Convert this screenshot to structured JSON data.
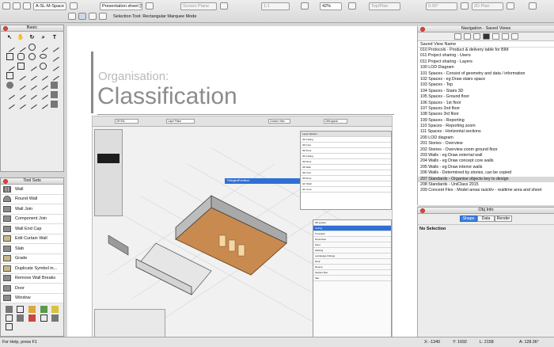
{
  "toolbar": {
    "class_select": "A-SL-M-Space",
    "sheet_select": "Presentation sheet [Sh...",
    "plane_select": "Screen Plane",
    "scale_value": "1:1",
    "zoom_value": "42%",
    "view_select": "Top/Plan",
    "angle_value": "0.00°",
    "render_select": "2D Plan",
    "status_text": "Selection Tool: Rectangular Marquee Mode"
  },
  "basic_palette": {
    "title": "Basic"
  },
  "tool_sets": {
    "title": "Tool Sets",
    "items": [
      "Wall",
      "Round Wall",
      "Wall Join",
      "Component Join",
      "Wall End Cap",
      "Edit Curtain Wall",
      "Slab",
      "Grade",
      "Duplicate Symbol in...",
      "Remove Wall Breaks",
      "Door",
      "Window"
    ]
  },
  "slide": {
    "subtitle": "Organisation:",
    "title": "Classification"
  },
  "embedded_screenshot": {
    "dropdown_label": "FittingIndFurniture",
    "field1": "Off  SSL",
    "field2": "Layer Plane",
    "field3": "Custom View",
    "field4": "Orthogonal",
    "layer_panel_header": "Layer Options",
    "layer_rows": [
      "3D Ceiling",
      "3D Core",
      "3D Floor",
      "3D Ceiling",
      "3D Floor",
      "3D Slab",
      "3D Core",
      "3D Floor",
      "GF Shell",
      "GF Core"
    ],
    "class_rows": [
      "3D system",
      "Ceiling",
      "Concepts",
      "Dimension",
      "Floor",
      "Glazing",
      "Landscape Fittings",
      "Roof",
      "Rooms",
      "Section Box",
      "Site"
    ]
  },
  "navigation": {
    "title": "Navigation - Saved Views",
    "column_header": "Saved View Name",
    "views": [
      "010 Protocols - Product & delivery table for BIM",
      "011 Project sharing - Users",
      "011 Project sharing - Layers",
      "100 LOD Diagram",
      "101 Spaces - Consist of geometry and data / information",
      "102 Spaces - eg Draw stairs space",
      "103 Spaces - Top",
      "104 Spaces - Stairs 3D",
      "105 Spaces - Ground floor",
      "106 Spaces - 1st floor",
      "107 Spaces 2nd floor",
      "108 Spaces 3rd floor",
      "109 Spaces - Reporting",
      "110 Spaces - Reporting zoom",
      "111 Spaces - Horizontal sections",
      "200 LOD diagram",
      "201 Stories - Overview",
      "202 Stories - Overview zoom ground floor",
      "203 Walls - eg Draw external wall",
      "204 Walls - eg Draw concept core walls",
      "205 Walls - eg Draw interior walls",
      "206 Walls - Determined by stories, can be copied",
      "207 Standards - Organise objects key to design",
      "208 Standards - UniClass 2015",
      "209 Concept Flex - Model areas quickly - realtime area and sheet"
    ],
    "selected_index": 22
  },
  "obj_info": {
    "title": "Obj Info",
    "tabs": [
      "Shape",
      "Data",
      "Render"
    ],
    "no_selection": "No Selection"
  },
  "status_bar": {
    "help": "For Help, press F1",
    "x": "X: -1340",
    "y": "Y: 1692",
    "l": "L: 2158",
    "a": "A: 128.36°"
  },
  "colors": {
    "accent_blue": "#2f6fd6",
    "close_red": "#e0443e",
    "floor_orange": "#c98a4f"
  }
}
